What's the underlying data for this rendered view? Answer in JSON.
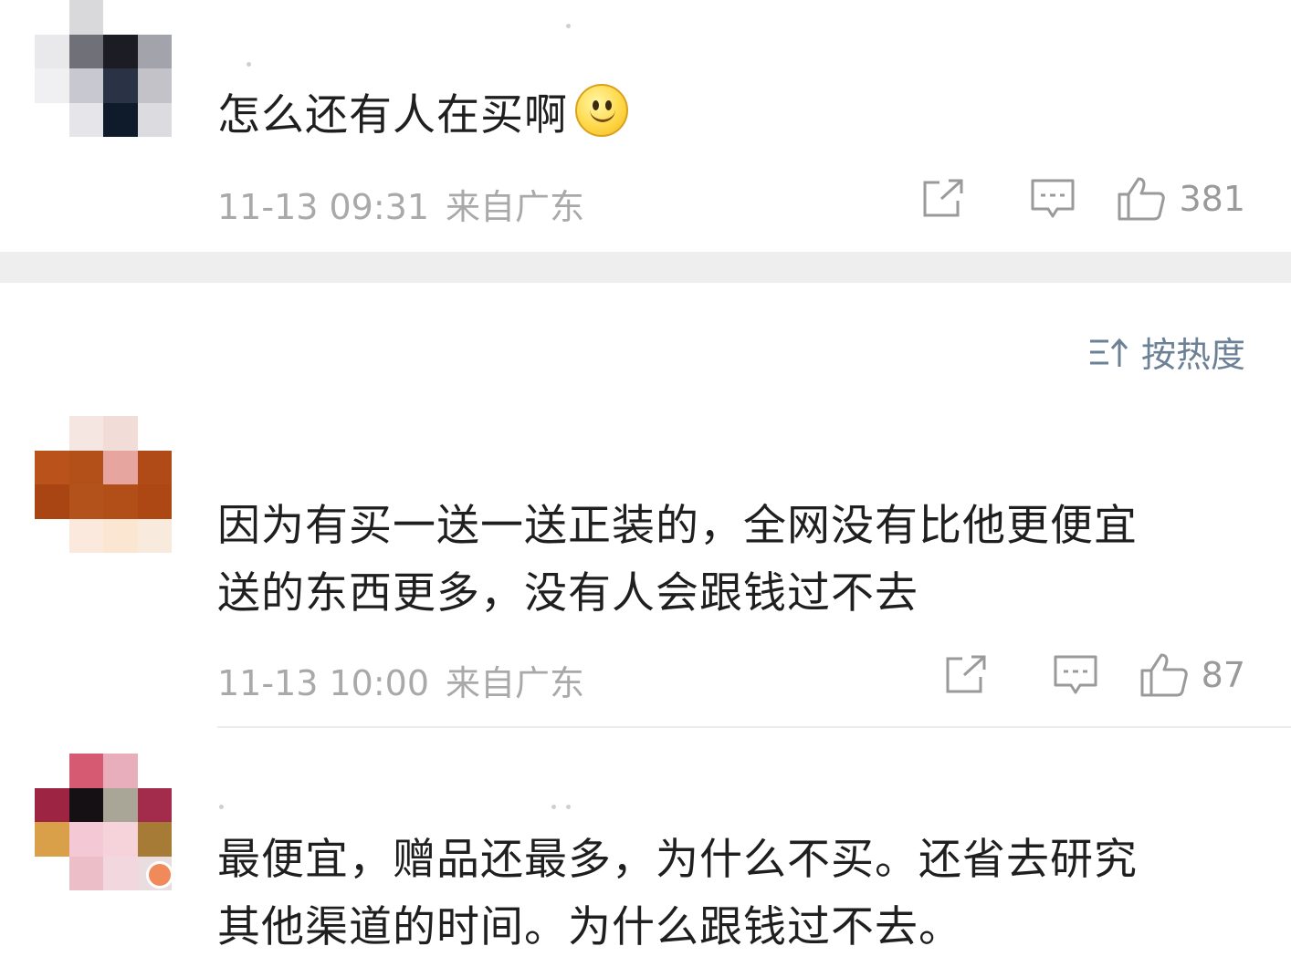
{
  "comments": [
    {
      "text": "怎么还有人在买啊",
      "emoji": "smile-icon",
      "date": "11-13 09:31",
      "location": "来自广东",
      "likes": "381"
    },
    {
      "text_line1": "因为有买一送一送正装的，全网没有比他更便宜",
      "text_line2": "送的东西更多，没有人会跟钱过不去",
      "date": "11-13 10:00",
      "location": "来自广东",
      "likes": "87"
    },
    {
      "text_line1": "最便宜，赠品还最多，为什么不买。还省去研究",
      "text_line2": "其他渠道的时间。为什么跟钱过不去。"
    }
  ],
  "sort": {
    "label": "按热度",
    "icon": "sort-icon"
  },
  "icons": {
    "share": "share-icon",
    "reply": "comment-icon",
    "like": "thumbs-up-icon"
  },
  "colors": {
    "text": "#1f1f1f",
    "meta": "#a9a9a9",
    "sort": "#6c8096",
    "band": "#eeeeee"
  }
}
